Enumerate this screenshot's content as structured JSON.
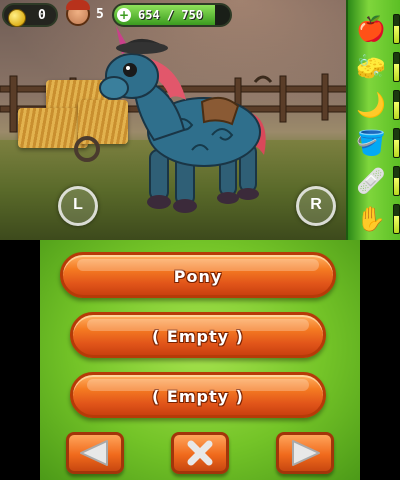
{
  "hud": {
    "coins": "0",
    "level": "5",
    "hp_text": "654 / 750",
    "hp_fraction": 0.872
  },
  "rotate_left": {
    "label": "L",
    "icon": "rotate-left-icon"
  },
  "rotate_right": {
    "label": "R",
    "icon": "rotate-right-icon"
  },
  "sidebar": [
    {
      "name": "food",
      "icon": "apple-carrot-icon",
      "glyph": "🍎",
      "level": 0.6
    },
    {
      "name": "grooming",
      "icon": "sponge-icon",
      "glyph": "🧽",
      "level": 0.6
    },
    {
      "name": "sleep",
      "icon": "moon-icon",
      "glyph": "🌙",
      "level": 0.6
    },
    {
      "name": "water",
      "icon": "bucket-icon",
      "glyph": "🪣",
      "level": 0.6
    },
    {
      "name": "health",
      "icon": "first-aid-icon",
      "glyph": "🩹",
      "level": 0.6
    },
    {
      "name": "pet",
      "icon": "hand-icon",
      "glyph": "✋",
      "level": 0.6
    }
  ],
  "slots": [
    {
      "label": "Pony"
    },
    {
      "label": "( Empty )"
    },
    {
      "label": "( Empty )"
    }
  ],
  "nav": {
    "prev_icon": "arrow-left-icon",
    "cancel_icon": "close-icon",
    "next_icon": "arrow-right-icon"
  },
  "colors": {
    "accent_orange": "#f57b22",
    "sidebar_green": "#5cbf25",
    "hp_green": "#3b9b1f"
  }
}
